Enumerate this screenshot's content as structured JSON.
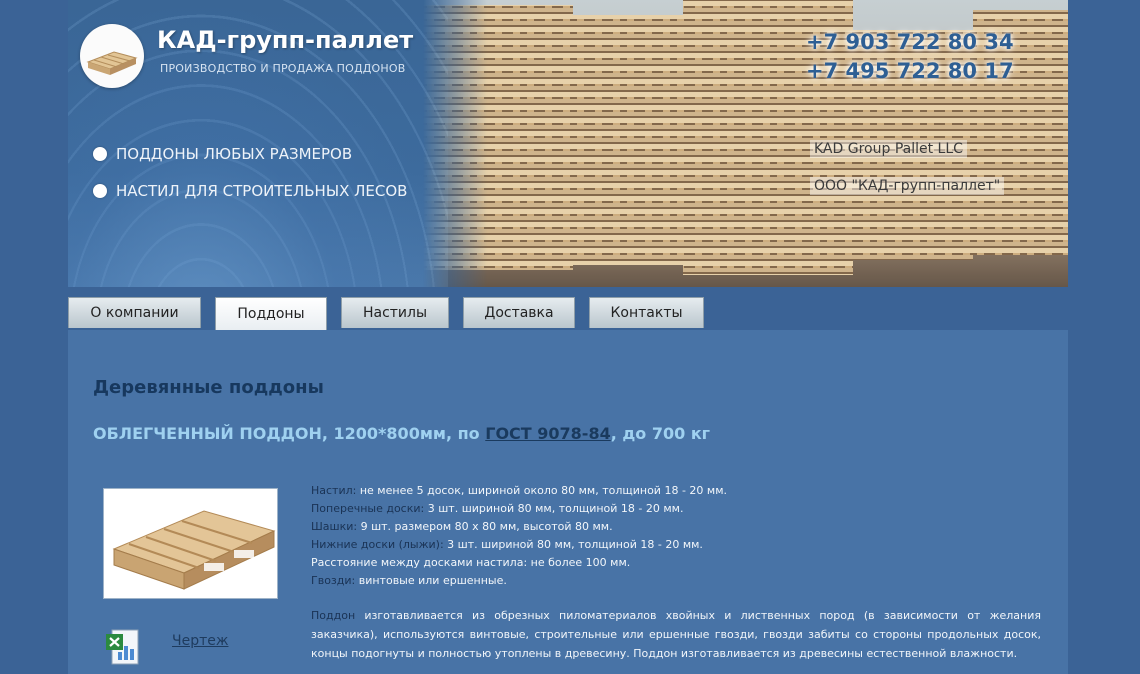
{
  "header": {
    "brand_title": "КАД-групп-паллет",
    "brand_subtitle": "ПРОИЗВОДСТВО И ПРОДАЖА ПОДДОНОВ",
    "bullets": [
      "ПОДДОНЫ ЛЮБЫХ РАЗМЕРОВ",
      "НАСТИЛ ДЛЯ СТРОИТЕЛЬНЫХ ЛЕСОВ"
    ],
    "phones": [
      "+7 903 722 80 34",
      "+7 495 722 80 17"
    ],
    "company_en": "KAD Group Pallet LLC",
    "company_ru": "ООО \"КАД-групп-паллет\""
  },
  "nav": {
    "tabs": [
      {
        "label": "О компании",
        "active": false
      },
      {
        "label": "Поддоны",
        "active": true
      },
      {
        "label": "Настилы",
        "active": false
      },
      {
        "label": "Доставка",
        "active": false
      },
      {
        "label": "Контакты",
        "active": false
      }
    ]
  },
  "main": {
    "page_title": "Деревянные поддоны",
    "product_title_prefix": "ОБЛЕГЧЕННЫЙ ПОДДОН, 1200*800мм, по ",
    "product_title_link": "ГОСТ 9078-84",
    "product_title_suffix": ", до 700 кг",
    "drawing_link": "Чертеж",
    "specs": [
      {
        "key": "Настил:",
        "value": " не менее 5 досок, шириной около 80 мм, толщиной 18 - 20 мм."
      },
      {
        "key": "Поперечные доски:",
        "value": " 3 шт. шириной 80 мм, толщиной 18 - 20 мм."
      },
      {
        "key": "Шашки:",
        "value": " 9 шт. размером 80 х 80 мм, высотой 80 мм."
      },
      {
        "key": "Нижние доски (лыжи):",
        "value": " 3 шт. шириной 80 мм, толщиной 18 - 20 мм."
      },
      {
        "key": "",
        "value": "Расстояние между досками настила: не более 100 мм."
      },
      {
        "key": "Гвозди:",
        "value": " винтовые или ершенные."
      }
    ],
    "description_key": "Поддон",
    "description_text": " изготавливается из обрезных пиломатериалов хвойных и лиственных пород (в зависимости от желания заказчика), используются винтовые, строительные или ершенные гвозди, гвозди забиты со стороны продольных досок, концы подогнуты и полностью утоплены в древесину. Поддон изготавливается из древесины естественной влажности."
  },
  "colors": {
    "background": "#3b6396",
    "content": "#4873a6",
    "phone": "#2e5f94",
    "product_title": "#9fd1f0",
    "spec_key": "#1a3355"
  }
}
